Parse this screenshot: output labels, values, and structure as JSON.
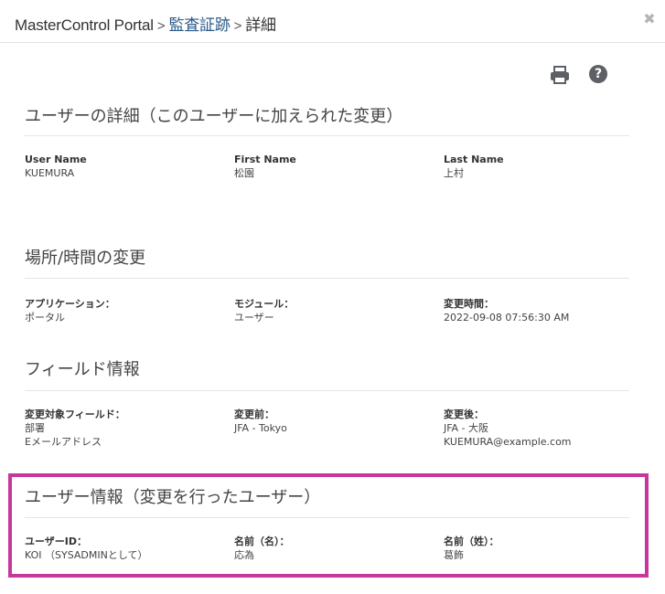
{
  "breadcrumb": {
    "root": "MasterControl Portal",
    "separator": ">",
    "audit_trail": "監査証跡",
    "current": "詳細"
  },
  "icons": {
    "close": "close-icon",
    "print": "print-icon",
    "help": "help-icon"
  },
  "sections": {
    "user_details": {
      "title": "ユーザーの詳細（このユーザーに加えられた変更）",
      "user_name_label": "User Name",
      "user_name_value": "KUEMURA",
      "first_name_label": "First Name",
      "first_name_value": "松園",
      "last_name_label": "Last Name",
      "last_name_value": "上村"
    },
    "location_time": {
      "title": "場所/時間の変更",
      "application_label": "アプリケーション：",
      "application_value": "ポータル",
      "module_label": "モジュール：",
      "module_value": "ユーザー",
      "changed_at_label": "変更時間：",
      "changed_at_value": "2022-09-08 07:56:30 AM"
    },
    "field_info": {
      "title": "フィールド情報",
      "changed_field_label": "変更対象フィールド：",
      "changed_field_values": [
        "部署",
        "Eメールアドレス"
      ],
      "before_label": "変更前：",
      "before_values": [
        "JFA - Tokyo"
      ],
      "after_label": "変更後：",
      "after_values": [
        "JFA - 大阪",
        "KUEMURA@example.com"
      ]
    },
    "changer_info": {
      "title": "ユーザー情報（変更を行ったユーザー）",
      "user_id_label": "ユーザーID：",
      "user_id_value": "KOI （SYSADMINとして）",
      "first_name_label": "名前（名）：",
      "first_name_value": "応為",
      "last_name_label": "名前（姓）：",
      "last_name_value": "葛飾"
    }
  },
  "colors": {
    "highlight_border": "#c6379b",
    "link": "#2a5a8a"
  }
}
